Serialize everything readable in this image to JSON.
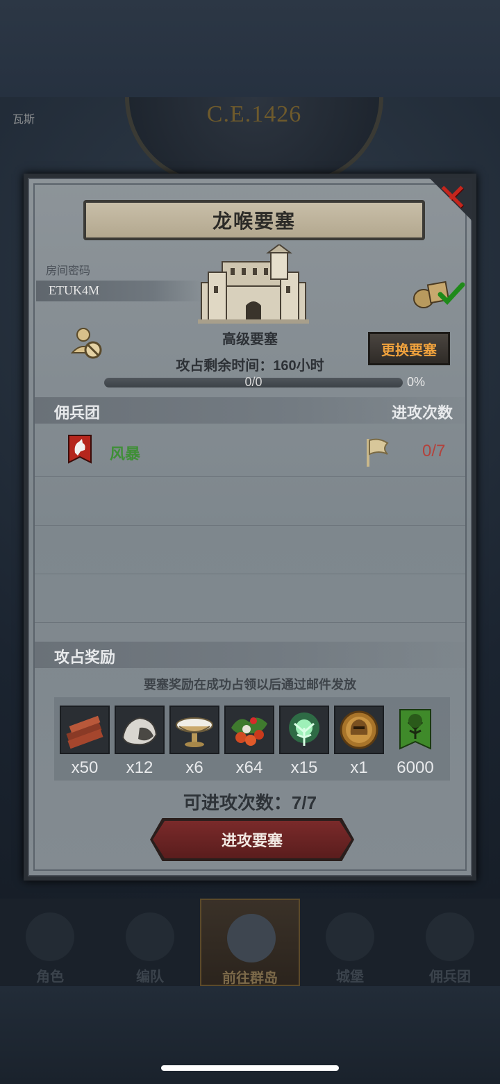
{
  "top": {
    "era": "C.E.1426",
    "left_tag": "瓦斯"
  },
  "modal": {
    "title": "龙喉要塞",
    "room_label": "房间密码",
    "room_code": "ETUK4M",
    "fortress_type": "高级要塞",
    "time_left": "攻占剩余时间：160小时",
    "change_button": "更换要塞",
    "progress": {
      "text": "0/0",
      "percent": "0%",
      "fraction": 0
    },
    "mercenary_section": {
      "title": "佣兵团",
      "right_title": "进攻次数"
    },
    "mercenaries": [
      {
        "name": "风暴",
        "attacks": "0/7",
        "emblem_icon": "wolf-banner-icon"
      }
    ],
    "reward_section": {
      "title": "攻占奖励",
      "note": "要塞奖励在成功占领以后通过邮件发放"
    },
    "rewards": [
      {
        "icon": "wood-icon",
        "qty": "x50"
      },
      {
        "icon": "ore-icon",
        "qty": "x12"
      },
      {
        "icon": "dish-icon",
        "qty": "x6"
      },
      {
        "icon": "berries-icon",
        "qty": "x64"
      },
      {
        "icon": "spirit-tree-icon",
        "qty": "x15"
      },
      {
        "icon": "helmet-medal-icon",
        "qty": "x1"
      },
      {
        "icon": "guild-banner-icon",
        "qty": "6000"
      }
    ],
    "attacks_left": "可进攻次数：7/7",
    "attack_button": "进攻要塞"
  },
  "nav": [
    {
      "label": "角色",
      "active": false
    },
    {
      "label": "编队",
      "active": false
    },
    {
      "label": "前往群岛",
      "active": true
    },
    {
      "label": "城堡",
      "active": false
    },
    {
      "label": "佣兵团",
      "active": false
    }
  ],
  "colors": {
    "accent": "#f0a23d",
    "merc_name": "#3f8f37",
    "attack_count": "#b3423c",
    "close": "#c4261d"
  }
}
